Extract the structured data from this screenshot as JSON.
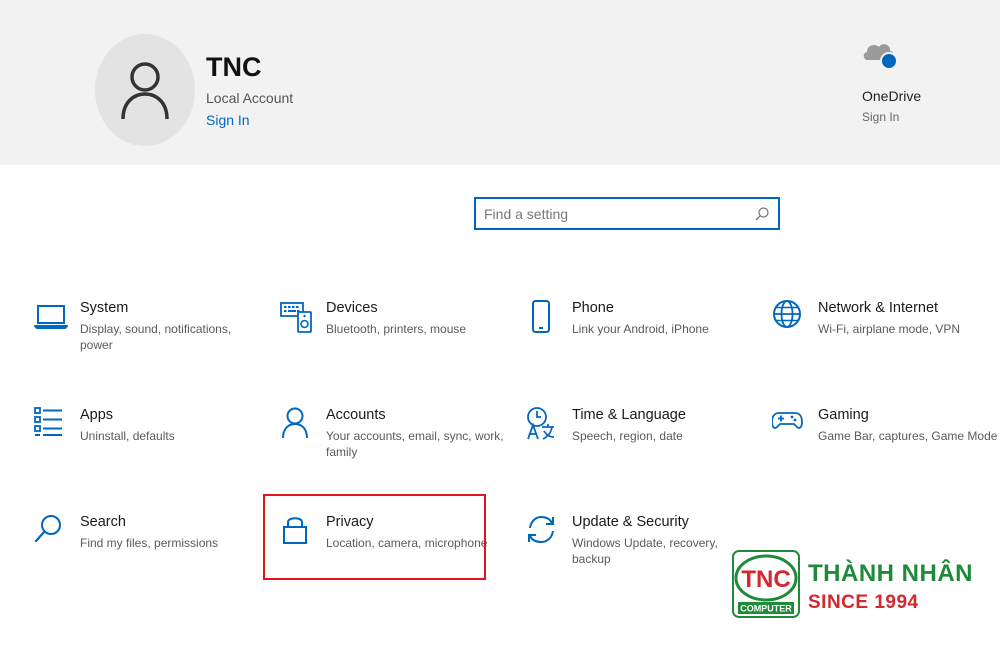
{
  "account": {
    "name": "TNC",
    "type": "Local Account",
    "sign_in": "Sign In"
  },
  "onedrive": {
    "label": "OneDrive",
    "sign_in": "Sign In"
  },
  "search": {
    "placeholder": "Find a setting"
  },
  "tiles": [
    {
      "title": "System",
      "desc": "Display, sound, notifications, power",
      "icon": "laptop-icon"
    },
    {
      "title": "Devices",
      "desc": "Bluetooth, printers, mouse",
      "icon": "devices-icon"
    },
    {
      "title": "Phone",
      "desc": "Link your Android, iPhone",
      "icon": "phone-icon"
    },
    {
      "title": "Network & Internet",
      "desc": "Wi-Fi, airplane mode, VPN",
      "icon": "globe-icon"
    },
    {
      "title": "Apps",
      "desc": "Uninstall, defaults",
      "icon": "apps-list-icon"
    },
    {
      "title": "Accounts",
      "desc": "Your accounts, email, sync, work, family",
      "icon": "person-icon"
    },
    {
      "title": "Time & Language",
      "desc": "Speech, region, date",
      "icon": "time-language-icon"
    },
    {
      "title": "Gaming",
      "desc": "Game Bar, captures, Game Mode",
      "icon": "gamepad-icon"
    },
    {
      "title": "Search",
      "desc": "Find my files, permissions",
      "icon": "magnifier-icon"
    },
    {
      "title": "Privacy",
      "desc": "Location, camera, microphone",
      "icon": "lock-icon"
    },
    {
      "title": "Update & Security",
      "desc": "Windows Update, recovery, backup",
      "icon": "sync-arrows-icon"
    }
  ],
  "brand": {
    "badge_text": "TNC",
    "badge_sub": "COMPUTER",
    "name": "THÀNH NHÂN",
    "since": "SINCE 1994"
  },
  "colors": {
    "accent": "#0067c0",
    "highlight": "#e3141a",
    "brand_green": "#1f8a3a",
    "brand_red": "#d6262e"
  }
}
